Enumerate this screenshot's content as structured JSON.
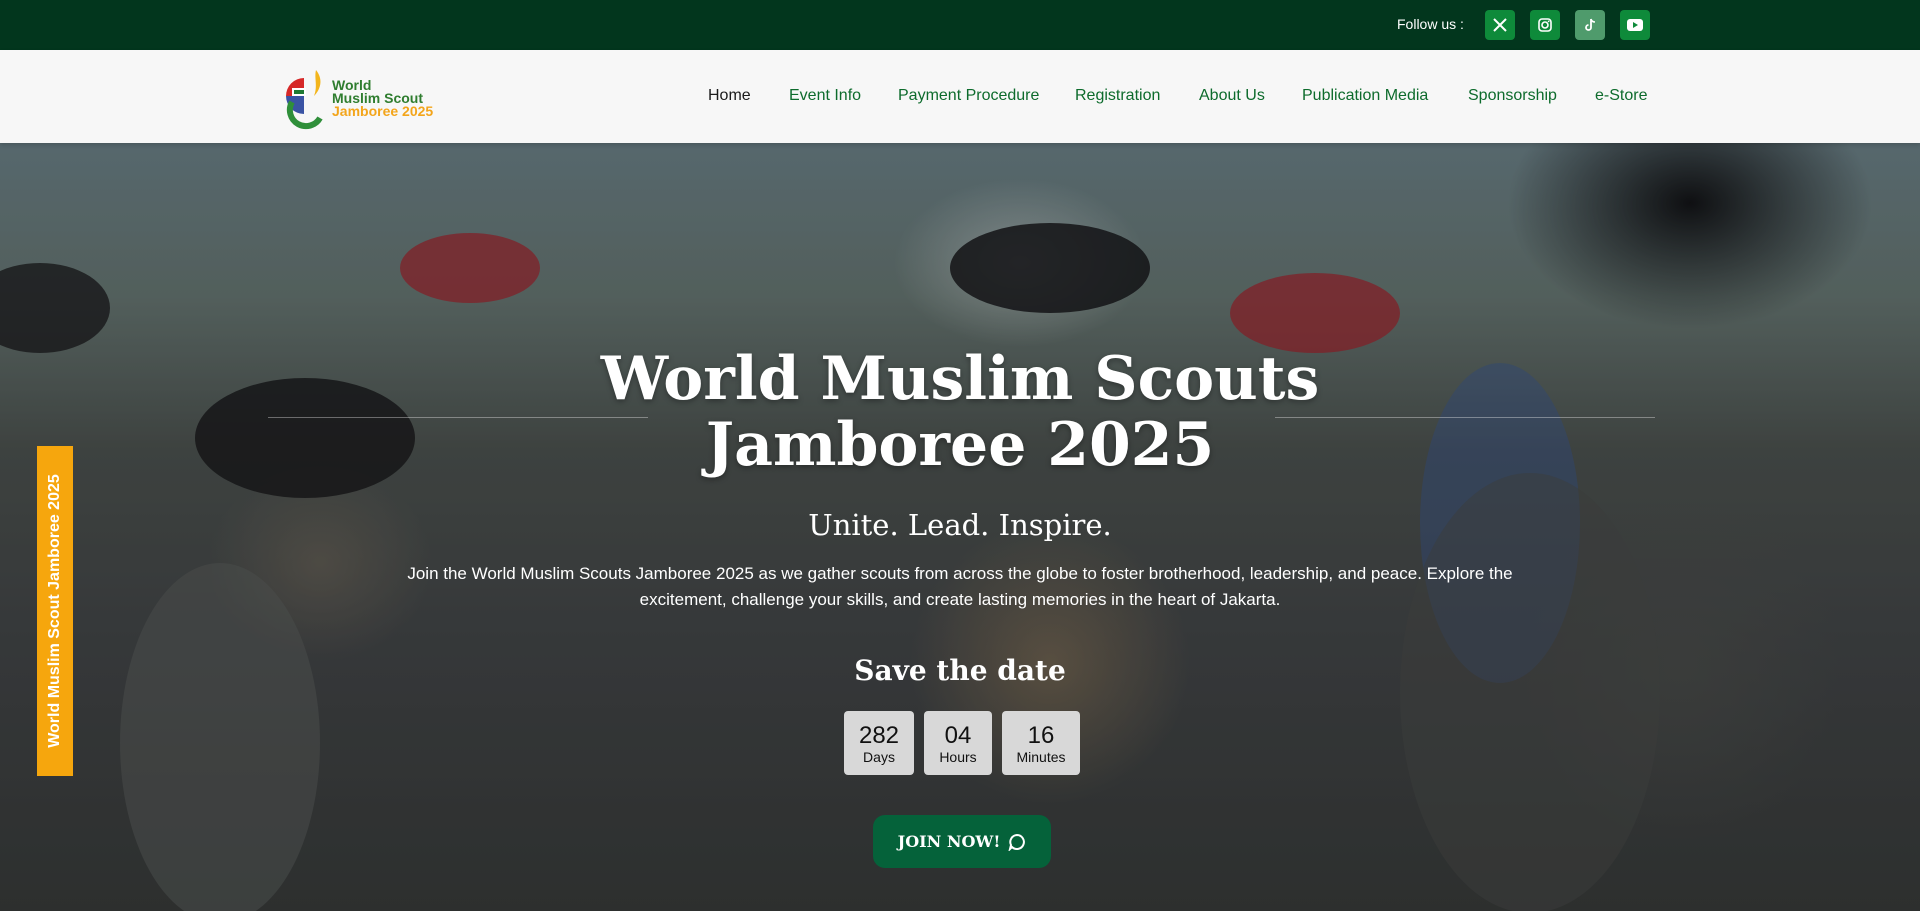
{
  "topbar": {
    "follow_label": "Follow us :",
    "socials": [
      {
        "name": "x-icon"
      },
      {
        "name": "instagram-icon"
      },
      {
        "name": "tiktok-icon"
      },
      {
        "name": "youtube-icon"
      }
    ],
    "colors": {
      "bar": "#02361d",
      "social": "#0e8a3a",
      "social_alt": "#4f9b6c"
    }
  },
  "logo": {
    "line1": "World",
    "line2": "Muslim Scout",
    "line3": "Jamboree 2025"
  },
  "nav": {
    "items": [
      "Home",
      "Event Info",
      "Payment Procedure",
      "Registration",
      "About Us",
      "Publication Media",
      "Sponsorship",
      "e-Store"
    ],
    "active": "Home"
  },
  "hero": {
    "title_line1": "World Muslim Scouts",
    "title_line2": "Jamboree 2025",
    "tagline": "Unite. Lead. Inspire.",
    "description": "Join the World Muslim Scouts Jamboree 2025 as we gather scouts from across the globe to foster brotherhood, leadership, and peace. Explore the excitement, challenge your skills, and create lasting memories in the heart of Jakarta.",
    "save_date": "Save the date",
    "countdown": {
      "days": "282",
      "days_label": "Days",
      "hours": "04",
      "hours_label": "Hours",
      "minutes": "16",
      "minutes_label": "Minutes"
    },
    "join_label": "JOIN NOW!"
  },
  "side_tab": {
    "label": "World Muslim Scout Jamboree 2025",
    "color": "#f6a60d"
  }
}
